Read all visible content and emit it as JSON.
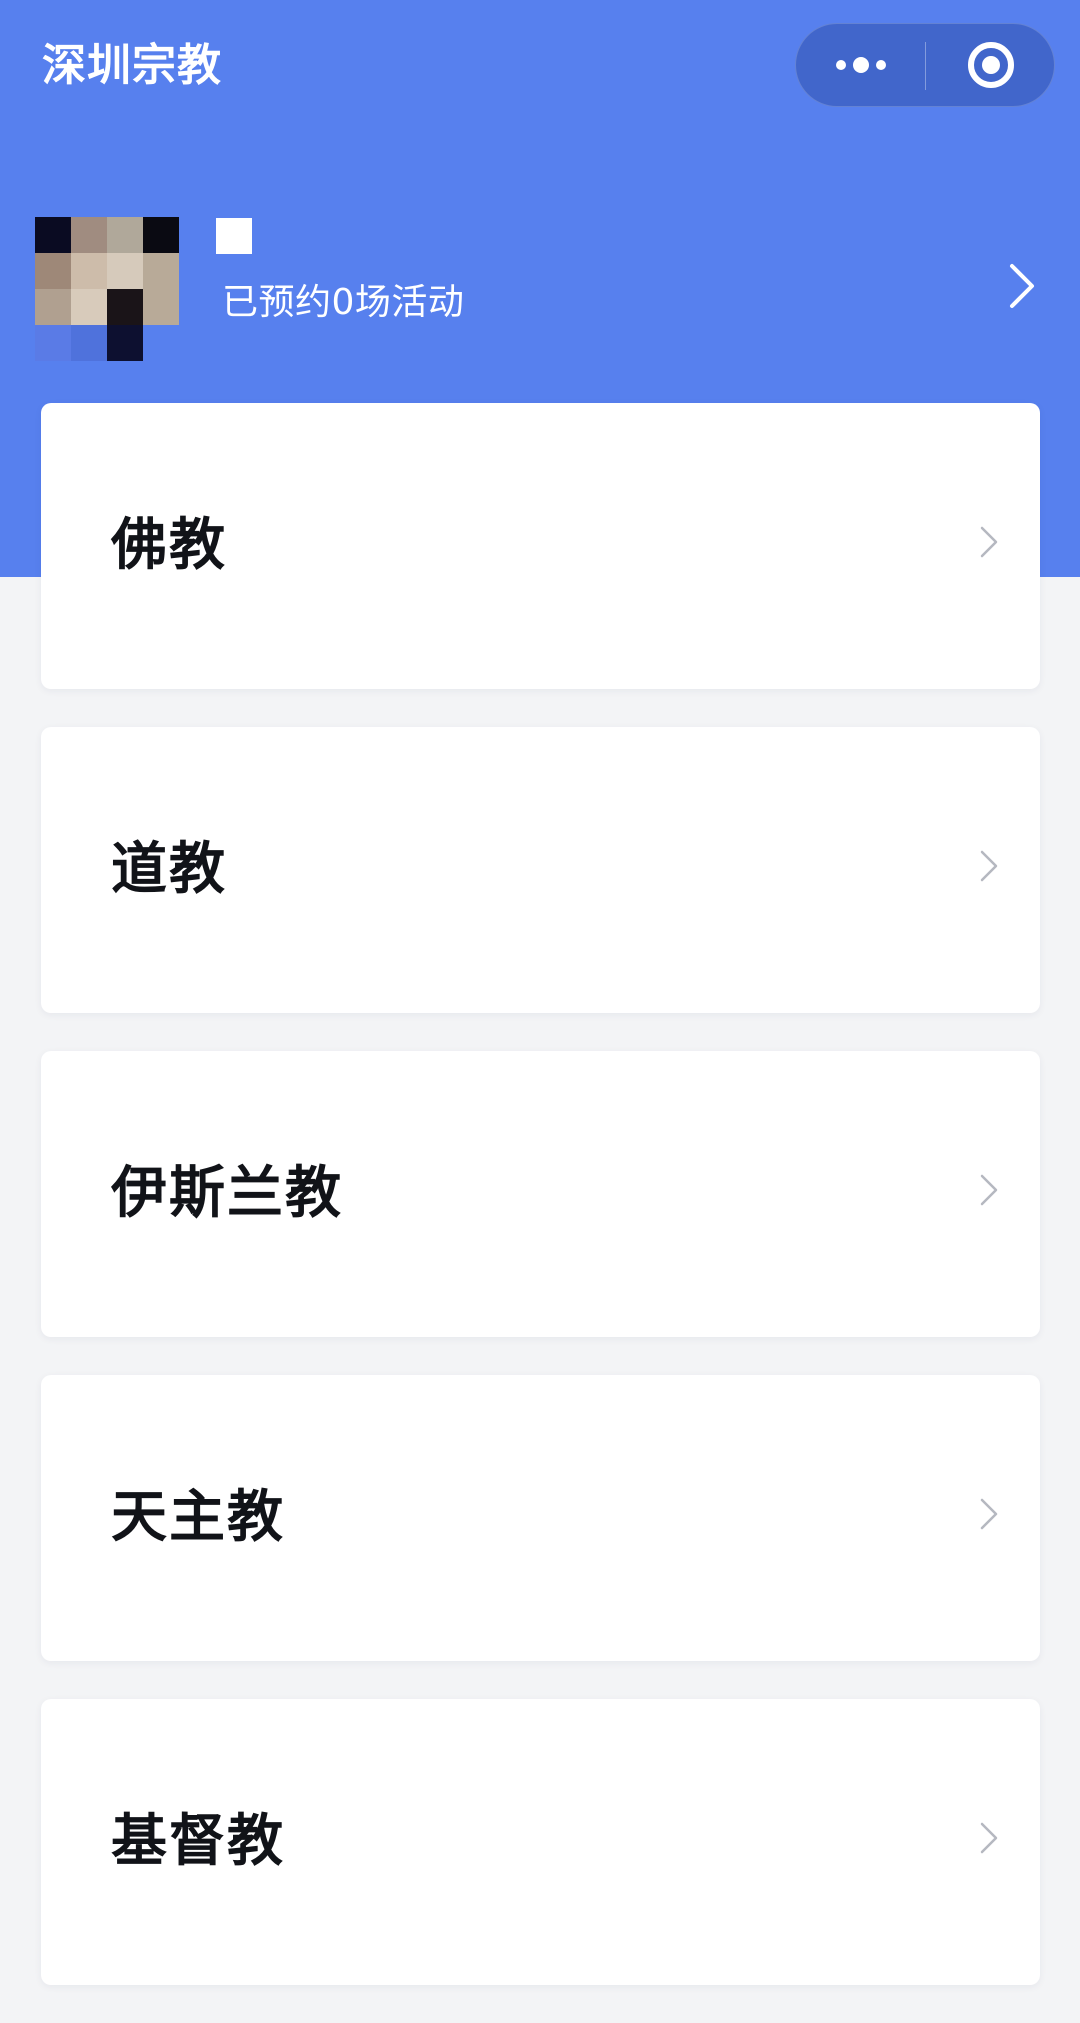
{
  "header": {
    "title": "深圳宗教",
    "menu_icon": "more-dots-icon",
    "close_icon": "target-close-icon"
  },
  "profile": {
    "avatar_icon": "avatar-pixelated",
    "stats_text": "已预约0场活动"
  },
  "categories": [
    {
      "label": "佛教"
    },
    {
      "label": "道教"
    },
    {
      "label": "伊斯兰教"
    },
    {
      "label": "天主教"
    },
    {
      "label": "基督教"
    }
  ],
  "colors": {
    "brand": "#5780ee",
    "background": "#f3f4f6",
    "card": "#ffffff",
    "text": "#111318",
    "chevron": "#b5b8c0"
  }
}
